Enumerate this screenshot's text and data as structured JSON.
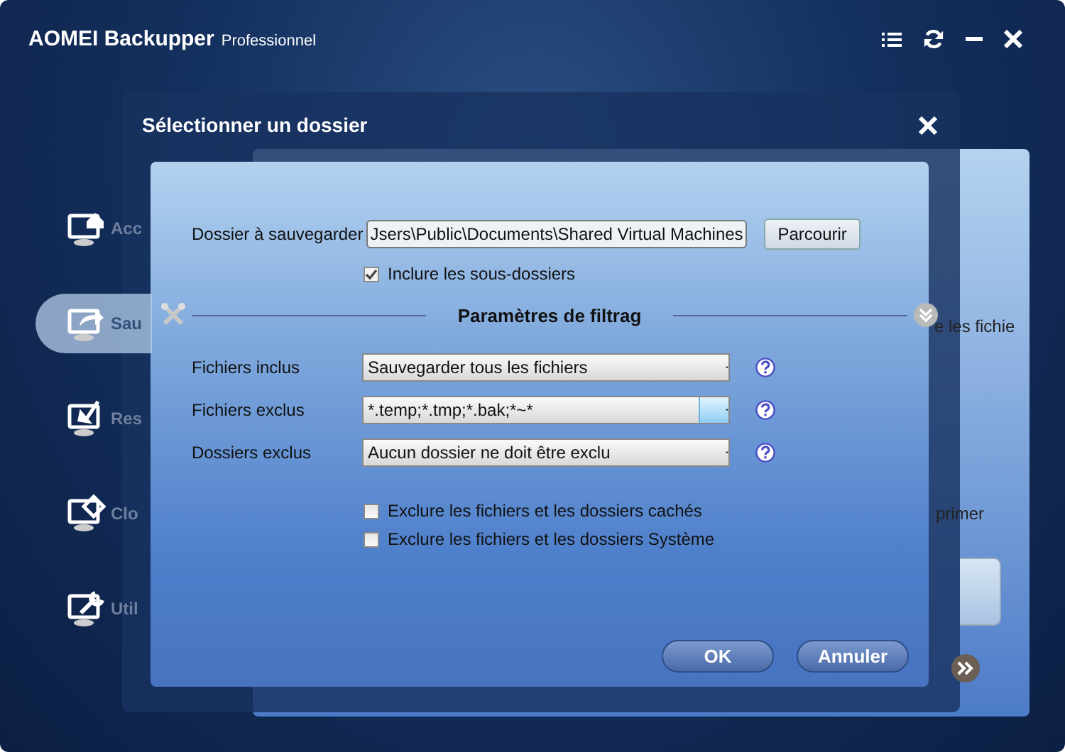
{
  "window": {
    "title": "AOMEI Backupper",
    "edition": "Professionnel"
  },
  "sidebar": {
    "items": [
      {
        "kind": "home",
        "label": "Acc",
        "selected": false
      },
      {
        "kind": "backup",
        "label": "Sau",
        "selected": true
      },
      {
        "kind": "restore",
        "label": "Res",
        "selected": false
      },
      {
        "kind": "clone",
        "label": "Clo",
        "selected": false
      },
      {
        "kind": "tools",
        "label": "Util",
        "selected": false
      }
    ]
  },
  "background_panel": {
    "tab_label": "e les fichie",
    "button_label": "primer"
  },
  "dialog": {
    "title": "Sélectionner un dossier",
    "folder_label": "Dossier à sauvegarder",
    "folder_path": "Jsers\\Public\\Documents\\Shared Virtual Machines",
    "browse_button": "Parcourir",
    "include_subfolders": {
      "label": "Inclure les sous-dossiers",
      "checked": true
    },
    "filter_title": "Paramètres de filtrag",
    "filters": [
      {
        "label": "Fichiers inclus",
        "value": "Sauvegarder tous les fichiers",
        "selected": false
      },
      {
        "label": "Fichiers exclus",
        "value": "*.temp;*.tmp;*.bak;*~*",
        "selected": true
      },
      {
        "label": "Dossiers exclus",
        "value": "Aucun dossier ne doit être exclu",
        "selected": false
      }
    ],
    "options": [
      {
        "label": "Exclure les fichiers et les dossiers cachés",
        "checked": false
      },
      {
        "label": "Exclure les fichiers et les dossiers Système",
        "checked": false
      }
    ],
    "buttons": [
      "OK",
      "Annuler"
    ]
  }
}
